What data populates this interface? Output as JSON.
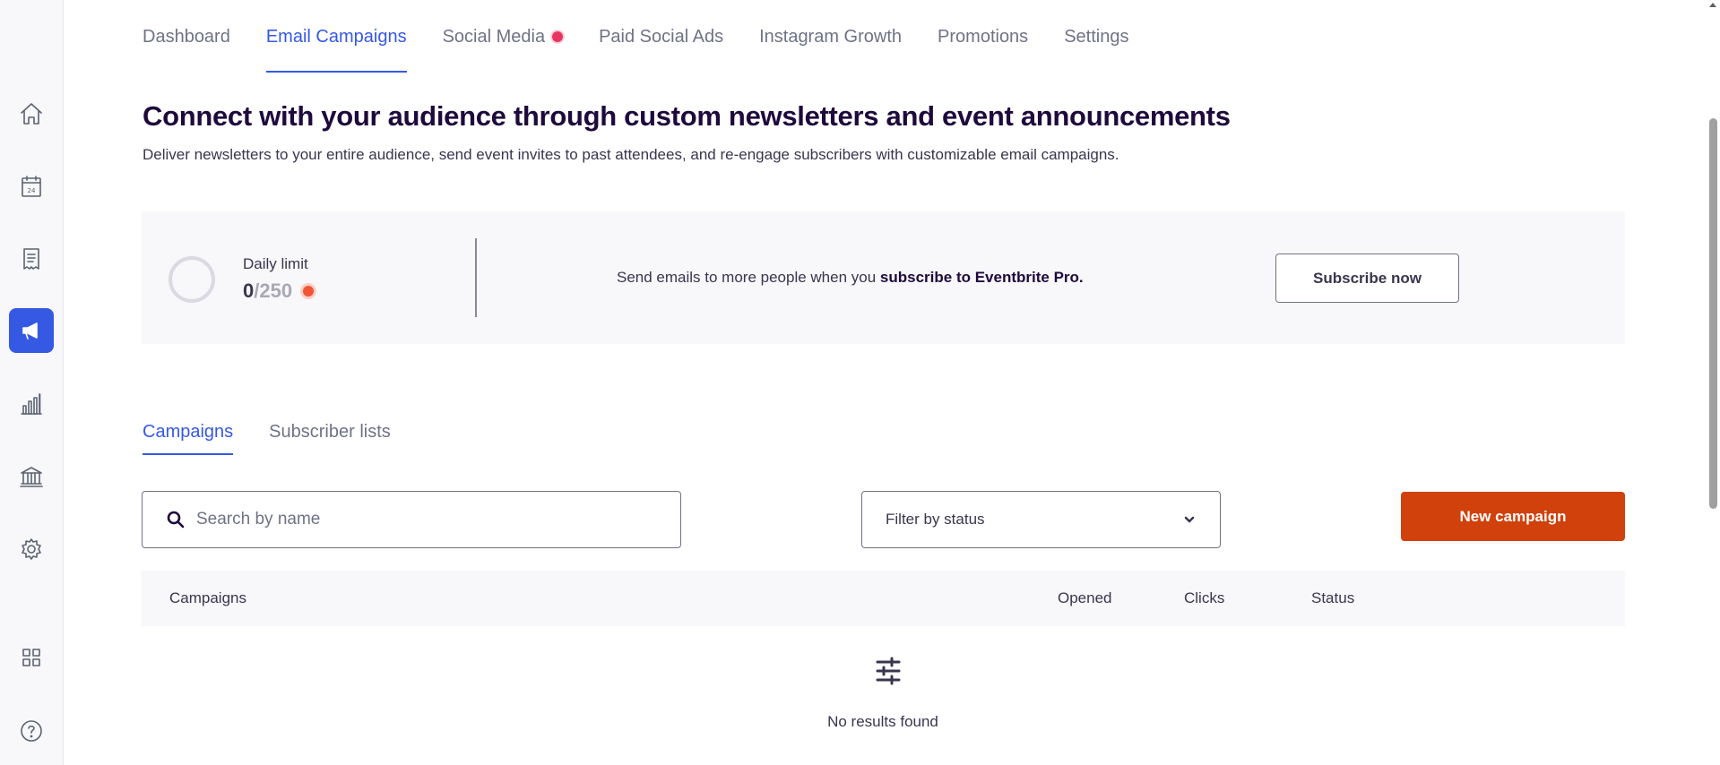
{
  "sidebar": {
    "items": [
      {
        "name": "home-icon",
        "active": false
      },
      {
        "name": "calendar-icon",
        "label": "24",
        "active": false
      },
      {
        "name": "receipt-icon",
        "active": false
      },
      {
        "name": "megaphone-icon",
        "active": true
      },
      {
        "name": "bar-chart-icon",
        "active": false
      },
      {
        "name": "bank-icon",
        "active": false
      },
      {
        "name": "gear-icon",
        "active": false
      },
      {
        "name": "apps-grid-icon",
        "active": false
      },
      {
        "name": "help-icon",
        "active": false
      }
    ]
  },
  "top_tabs": [
    {
      "label": "Dashboard",
      "active": false
    },
    {
      "label": "Email Campaigns",
      "active": true
    },
    {
      "label": "Social Media",
      "active": false,
      "notification": true
    },
    {
      "label": "Paid Social Ads",
      "active": false
    },
    {
      "label": "Instagram Growth",
      "active": false
    },
    {
      "label": "Promotions",
      "active": false
    },
    {
      "label": "Settings",
      "active": false
    }
  ],
  "header": {
    "title": "Connect with your audience through custom newsletters and event announcements",
    "subtitle": "Deliver newsletters to your entire audience, send event invites to past attendees, and re-engage subscribers with customizable email campaigns."
  },
  "limit_banner": {
    "label": "Daily limit",
    "used": "0",
    "max": "/250",
    "promo_prefix": "Send emails to more people when you ",
    "promo_bold": "subscribe to Eventbrite Pro.",
    "subscribe_label": "Subscribe now"
  },
  "sub_tabs": [
    {
      "label": "Campaigns",
      "active": true
    },
    {
      "label": "Subscriber lists",
      "active": false
    }
  ],
  "controls": {
    "search_placeholder": "Search by name",
    "search_value": "",
    "status_filter": "Filter by status",
    "new_campaign_label": "New campaign"
  },
  "table": {
    "columns": [
      "Campaigns",
      "Opened",
      "Clicks",
      "Status"
    ],
    "rows": [],
    "empty_text": "No results found"
  },
  "colors": {
    "accent": "#3659e3",
    "primary_button": "#d1410c",
    "notification": "#ea3460"
  }
}
